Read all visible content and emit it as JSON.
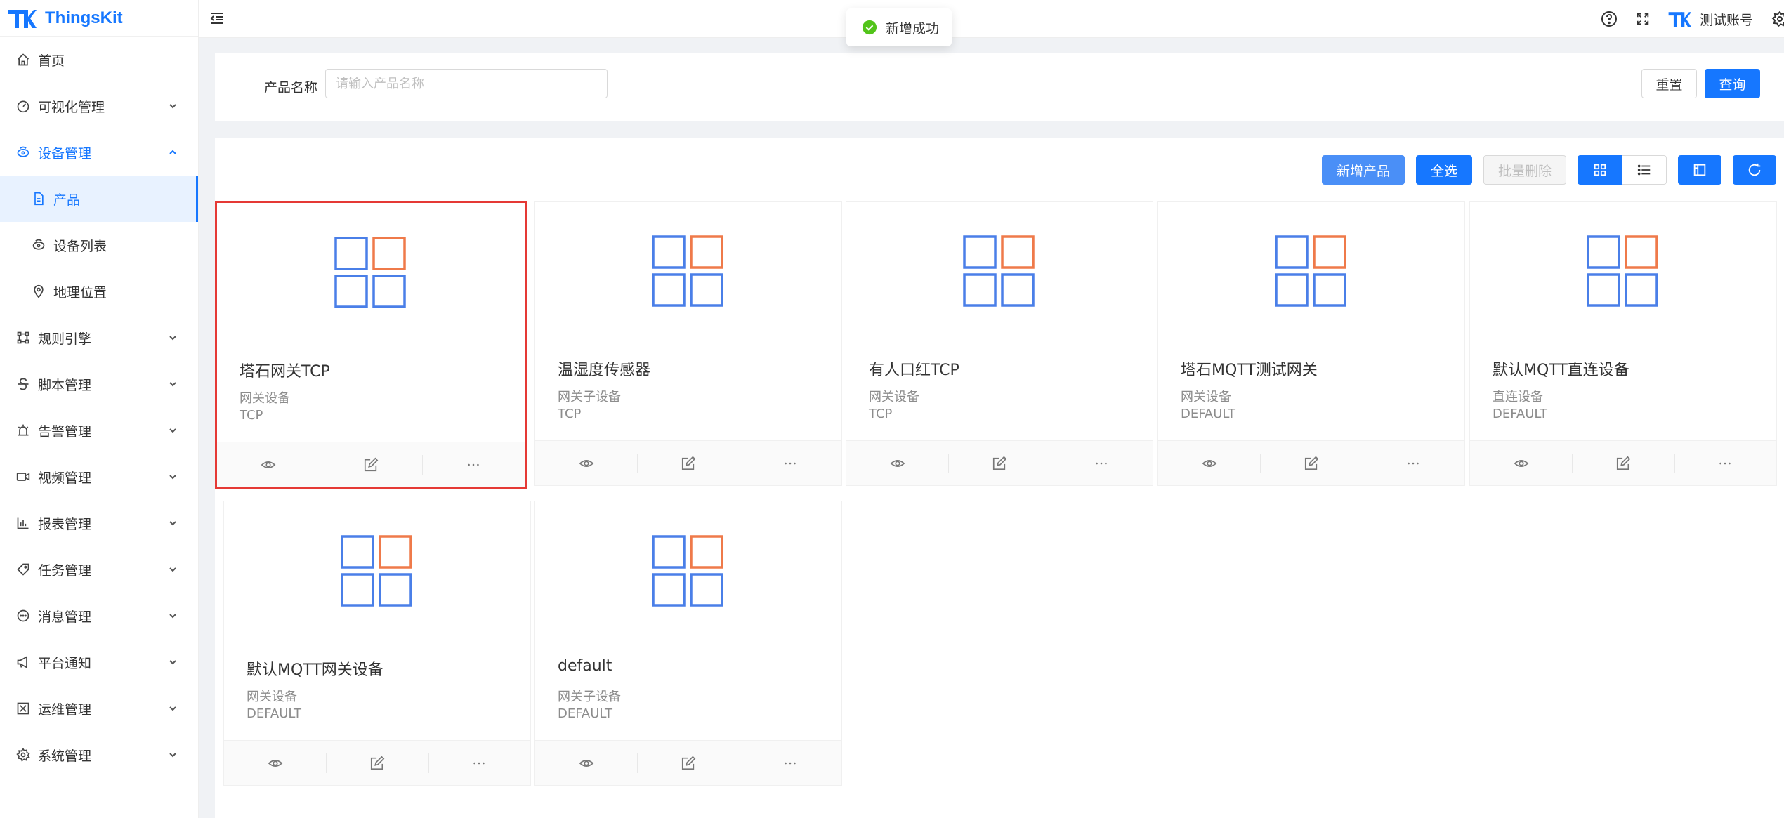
{
  "app": {
    "name": "ThingsKit"
  },
  "sidebar": {
    "items": [
      {
        "label": "首页",
        "icon": "home-icon",
        "has_children": false
      },
      {
        "label": "可视化管理",
        "icon": "dashboard-icon",
        "has_children": true
      },
      {
        "label": "设备管理",
        "icon": "device-icon",
        "has_children": true,
        "open": true,
        "children": [
          {
            "label": "产品",
            "icon": "file-icon",
            "active": true
          },
          {
            "label": "设备列表",
            "icon": "device-icon",
            "active": false
          },
          {
            "label": "地理位置",
            "icon": "location-icon",
            "active": false
          }
        ]
      },
      {
        "label": "规则引擎",
        "icon": "rule-icon",
        "has_children": true
      },
      {
        "label": "脚本管理",
        "icon": "script-icon",
        "has_children": true
      },
      {
        "label": "告警管理",
        "icon": "alarm-icon",
        "has_children": true
      },
      {
        "label": "视频管理",
        "icon": "video-icon",
        "has_children": true
      },
      {
        "label": "报表管理",
        "icon": "chart-icon",
        "has_children": true
      },
      {
        "label": "任务管理",
        "icon": "tag-icon",
        "has_children": true
      },
      {
        "label": "消息管理",
        "icon": "message-icon",
        "has_children": true
      },
      {
        "label": "平台通知",
        "icon": "megaphone-icon",
        "has_children": true
      },
      {
        "label": "运维管理",
        "icon": "ops-icon",
        "has_children": true
      },
      {
        "label": "系统管理",
        "icon": "gear-icon",
        "has_children": true
      }
    ]
  },
  "header": {
    "user": "测试账号"
  },
  "toast": {
    "message": "新增成功"
  },
  "search": {
    "label": "产品名称",
    "placeholder": "请输入产品名称",
    "value": "",
    "reset_label": "重置",
    "query_label": "查询"
  },
  "toolbar": {
    "add_label": "新增产品",
    "select_all_label": "全选",
    "batch_delete_label": "批量删除"
  },
  "colors": {
    "primary": "#1677ff",
    "icon_blue": "#4a7fe8",
    "icon_orange": "#ef7a4a",
    "selected_border": "#e53935",
    "toast_success": "#52c41a"
  },
  "products": [
    {
      "name": "塔石网关TCP",
      "type": "网关设备",
      "protocol": "TCP",
      "selected": true
    },
    {
      "name": "温湿度传感器",
      "type": "网关子设备",
      "protocol": "TCP",
      "selected": false
    },
    {
      "name": "有人口红TCP",
      "type": "网关设备",
      "protocol": "TCP",
      "selected": false
    },
    {
      "name": "塔石MQTT测试网关",
      "type": "网关设备",
      "protocol": "DEFAULT",
      "selected": false
    },
    {
      "name": "默认MQTT直连设备",
      "type": "直连设备",
      "protocol": "DEFAULT",
      "selected": false
    },
    {
      "name": "默认MQTT网关设备",
      "type": "网关设备",
      "protocol": "DEFAULT",
      "selected": false
    },
    {
      "name": "default",
      "type": "网关子设备",
      "protocol": "DEFAULT",
      "selected": false
    }
  ]
}
